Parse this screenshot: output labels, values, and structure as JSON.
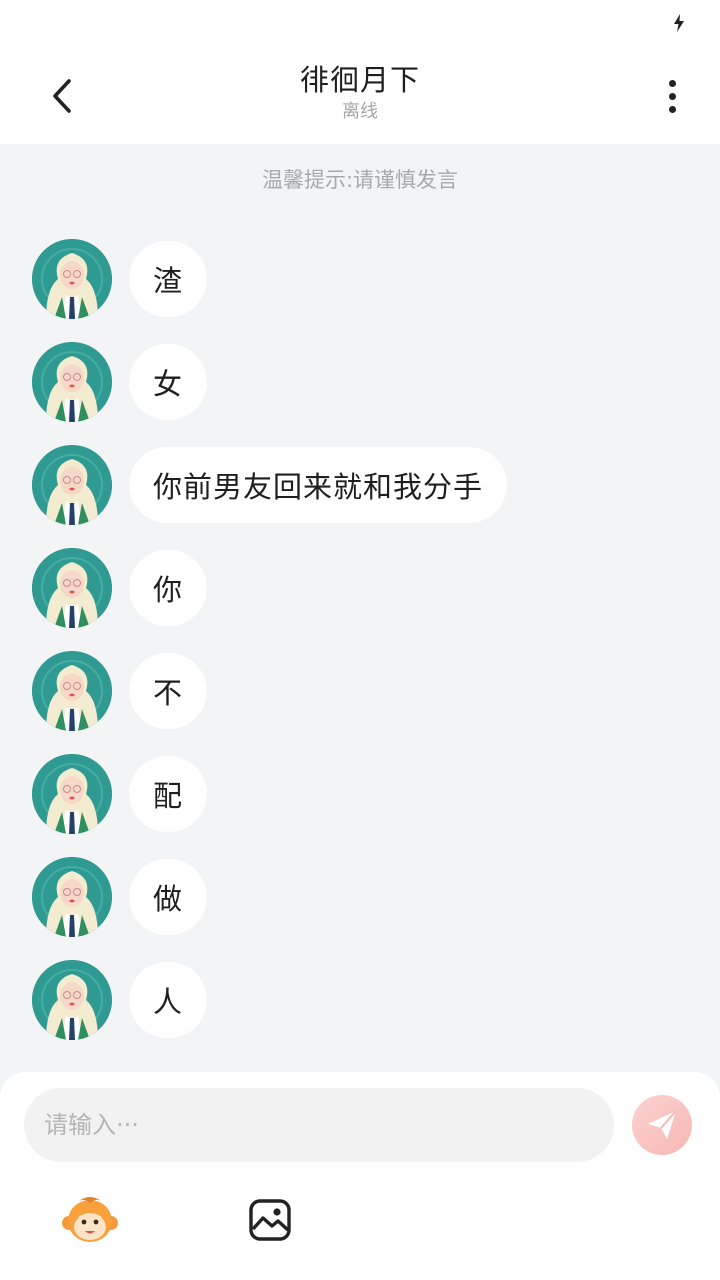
{
  "header": {
    "title": "徘徊月下",
    "status": "离线"
  },
  "notice": "温馨提示:请谨慎发言",
  "messages": [
    {
      "text": "渣"
    },
    {
      "text": "女"
    },
    {
      "text": "你前男友回来就和我分手"
    },
    {
      "text": "你"
    },
    {
      "text": "不"
    },
    {
      "text": "配"
    },
    {
      "text": "做"
    },
    {
      "text": "人"
    }
  ],
  "composer": {
    "placeholder": "请输入···"
  },
  "icons": {
    "back": "chevron-left-icon",
    "more": "more-vertical-icon",
    "send": "paper-plane-icon",
    "sticker": "monkey-face-icon",
    "image": "image-icon",
    "status": "lightning-bolt-icon"
  },
  "colors": {
    "background": "#f3f4f6",
    "bubble": "#ffffff",
    "send_button": "#f7b7b3",
    "muted_text": "#a9a9a9"
  }
}
